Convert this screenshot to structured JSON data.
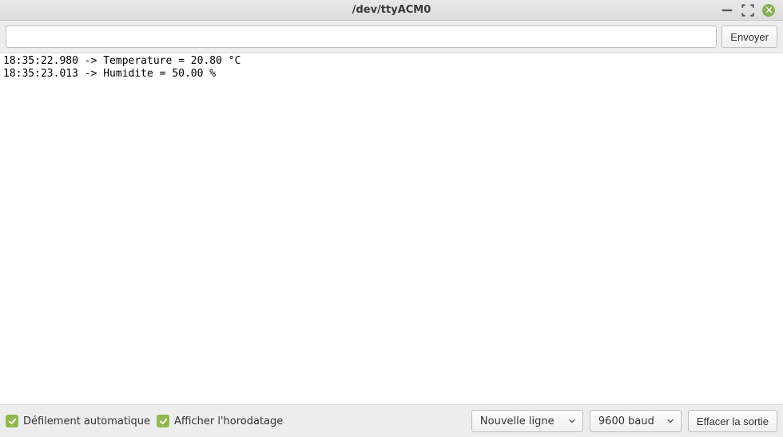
{
  "window": {
    "title": "/dev/ttyACM0"
  },
  "toolbar": {
    "input_value": "",
    "input_placeholder": "",
    "send_label": "Envoyer"
  },
  "output": {
    "lines": [
      "18:35:22.980 -> Temperature = 20.80 °C",
      "18:35:23.013 -> Humidite = 50.00 %"
    ]
  },
  "statusbar": {
    "autoscroll_label": "Défilement automatique",
    "timestamp_label": "Afficher l'horodatage",
    "line_ending_selected": "Nouvelle ligne",
    "baud_selected": "9600 baud",
    "clear_label": "Effacer la sortie",
    "autoscroll_checked": true,
    "timestamp_checked": true
  }
}
